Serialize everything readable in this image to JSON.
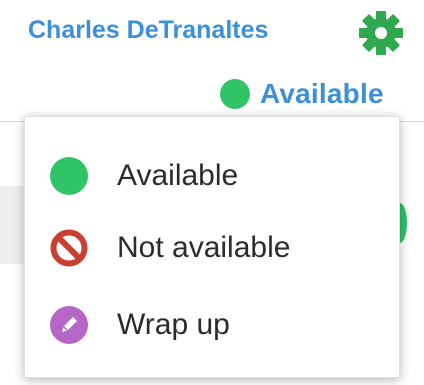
{
  "header": {
    "user_name": "Charles DeTranaltes",
    "settings_icon": "gear-icon",
    "status_label": "Available",
    "status_color": "#2fc567",
    "accent_color": "#3d8fd8"
  },
  "status_menu": {
    "items": [
      {
        "label": "Available",
        "icon": "green-dot-icon",
        "color": "#2fc567"
      },
      {
        "label": "Not available",
        "icon": "no-entry-icon",
        "color": "#c8402f"
      },
      {
        "label": "Wrap up",
        "icon": "pencil-icon",
        "color": "#b567c8"
      }
    ]
  }
}
